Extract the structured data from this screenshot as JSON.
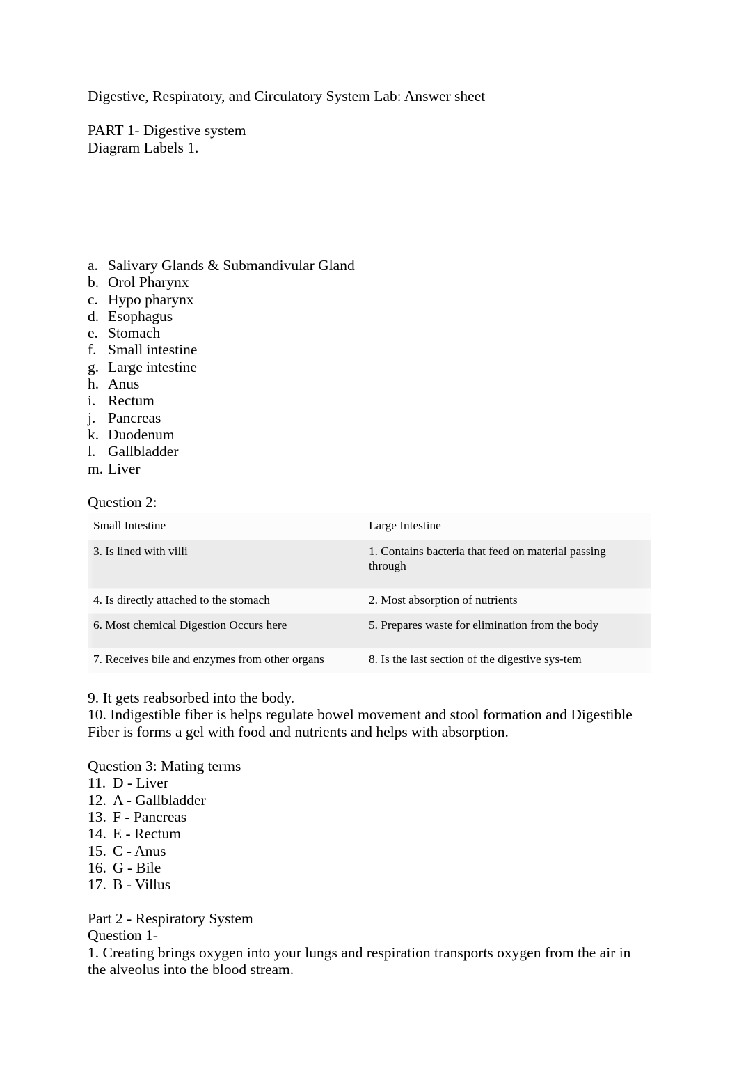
{
  "document": {
    "title": "Digestive, Respiratory, and Circulatory System Lab: Answer sheet"
  },
  "part1": {
    "heading": "PART 1- Digestive system",
    "diagram_label_line": "Diagram Labels 1.",
    "labels": [
      {
        "marker": "a.",
        "text": "Salivary Glands & Submandivular Gland"
      },
      {
        "marker": "b.",
        "text": "Orol Pharynx"
      },
      {
        "marker": "c.",
        "text": "Hypo pharynx"
      },
      {
        "marker": "d.",
        "text": "Esophagus"
      },
      {
        "marker": "e.",
        "text": "Stomach"
      },
      {
        "marker": "f.",
        "text": "Small intestine"
      },
      {
        "marker": "g.",
        "text": "Large intestine"
      },
      {
        "marker": "h.",
        "text": "Anus"
      },
      {
        "marker": "i.",
        "text": "Rectum"
      },
      {
        "marker": "j.",
        "text": "Pancreas"
      },
      {
        "marker": "k.",
        "text": "Duodenum"
      },
      {
        "marker": "l.",
        "text": "Gallbladder"
      },
      {
        "marker": "m.",
        "text": "Liver"
      }
    ]
  },
  "question2": {
    "label": "Question 2:",
    "table": {
      "headers": [
        "Small Intestine",
        "Large Intestine"
      ],
      "rows": [
        [
          "3. Is lined with villi",
          "1. Contains bacteria that feed on material passing through"
        ],
        [
          "4. Is directly attached to the stomach",
          "2. Most absorption of nutrients"
        ],
        [
          "6. Most chemical Digestion Occurs here",
          "5. Prepares waste for elimination from the body"
        ],
        [
          "7. Receives bile and enzymes from other organs",
          "8. Is the last section of the digestive sys-tem"
        ]
      ]
    },
    "answer_9": "9. It gets reabsorbed into the body.",
    "answer_10": "10. Indigestible fiber is helps regulate bowel movement and stool formation and Digestible Fiber is forms a gel with food and nutrients and helps with absorption."
  },
  "question3": {
    "label": "Question 3: Mating terms",
    "items": [
      {
        "marker": "11.",
        "text": "D - Liver"
      },
      {
        "marker": "12.",
        "text": "A - Gallbladder"
      },
      {
        "marker": "13.",
        "text": "F  - Pancreas"
      },
      {
        "marker": "14.",
        "text": "E  - Rectum"
      },
      {
        "marker": "15.",
        "text": "C  - Anus"
      },
      {
        "marker": "16.",
        "text": "G  - Bile"
      },
      {
        "marker": "17.",
        "text": "B - Villus"
      }
    ]
  },
  "part2": {
    "heading": "Part 2 - Respiratory System",
    "question_label": "Question 1-",
    "answer_1": "1. Creating brings oxygen into your lungs and respiration transports oxygen from the air in the alveolus into the blood stream."
  },
  "colors": {
    "page_background": "#ffffff",
    "text": "#000000",
    "table_row_shaded": "#ebebeb",
    "table_row_plain": "#fafafa",
    "table_header_background": "#fcfcfc"
  }
}
